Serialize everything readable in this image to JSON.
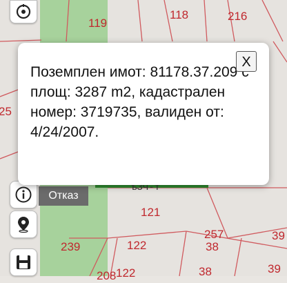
{
  "map": {
    "parcel_labels": [
      "119",
      "118",
      "216",
      "25",
      "121",
      "239",
      "122",
      "257",
      "38",
      "39",
      "38",
      "39",
      "122",
      "208"
    ],
    "road_label": "ѣЗЧ-т"
  },
  "controls": {
    "locate_icon": "locate-icon",
    "info_icon": "info-icon",
    "pin_icon": "map-pin-icon",
    "save_icon": "save-icon",
    "cancel_label": "Отказ"
  },
  "popup": {
    "text": "Поземплен имот: 81178.37.209 с площ: 3287 m2, кадастрален номер: 3719735, валиден от: 4/24/2007.",
    "close_label": "X"
  }
}
